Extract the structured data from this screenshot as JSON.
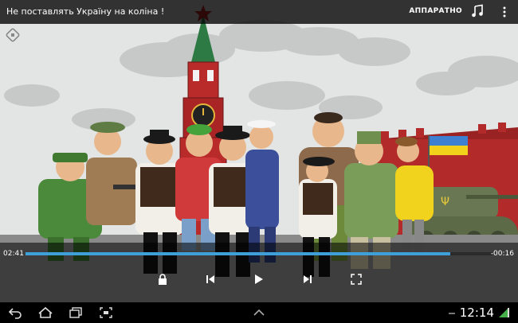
{
  "header": {
    "title": "Не поставлять Україну на коліна !",
    "hardware_label": "АППАРАТНО"
  },
  "player": {
    "elapsed": "02:41",
    "remaining": "-00:16",
    "progress": 0.91
  },
  "statusbar": {
    "time": "12:14"
  },
  "icons": [
    "rotate-lock-icon",
    "music-icon",
    "more-vert-icon",
    "lock-icon",
    "previous-icon",
    "play-icon",
    "next-icon",
    "fullscreen-icon",
    "back-icon",
    "home-icon",
    "recent-apps-icon",
    "screenshot-icon",
    "chevron-up-icon",
    "battery-icon"
  ],
  "colors": {
    "accent": "#3f9fd8",
    "kremlin_red": "#b92b2b",
    "flag_blue": "#3d7fd1",
    "flag_yellow": "#f3d21c"
  }
}
